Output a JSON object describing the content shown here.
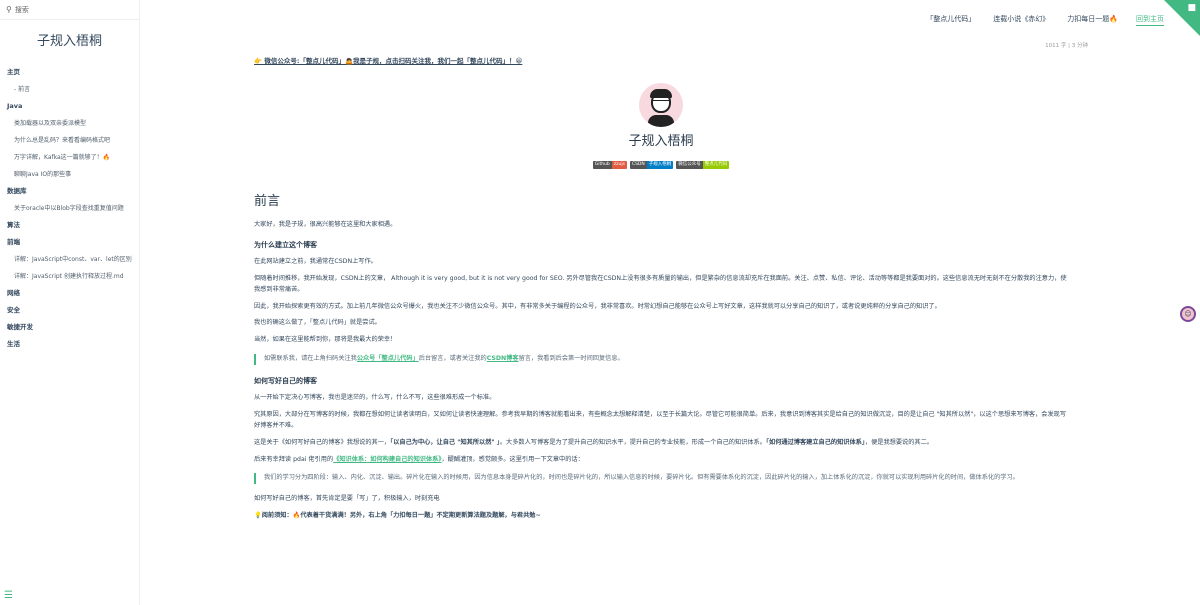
{
  "sidebar": {
    "search_placeholder": "搜索",
    "app_name": "子规入梧桐",
    "groups": [
      {
        "label": "主页",
        "items": [
          "- 前言"
        ]
      },
      {
        "label": "Java",
        "items": [
          "类加载器以及双亲委派模型",
          "为什么总是乱码？来看看编码格式吧",
          "万字详解，Kafka这一篇就够了！🔥",
          "聊聊Java IO的那些事"
        ]
      },
      {
        "label": "数据库",
        "items": [
          "关于oracle中以Blob字段查找重复值问题"
        ]
      },
      {
        "label": "算法",
        "items": []
      },
      {
        "label": "前端",
        "items": [
          "详解：JavaScript中const、var、let的区别",
          "详解：JavaScript 创建执行释放过程.md"
        ]
      },
      {
        "label": "网络",
        "items": []
      },
      {
        "label": "安全",
        "items": []
      },
      {
        "label": "敏捷开发",
        "items": []
      },
      {
        "label": "生活",
        "items": []
      }
    ]
  },
  "topnav": {
    "items": [
      "「整点儿代码」",
      "连载小说《赤幻》",
      "力扣每日一题🔥",
      "回到主页"
    ]
  },
  "meta": {
    "wordcount": "1011 字 | 3 分钟"
  },
  "content": {
    "notice": "👉 微信公众号:「整点儿代码」🙇我是子规，点击扫码关注我，我们一起「整点儿代码」！😀",
    "profile_name": "子规入梧桐",
    "badges": [
      {
        "k": "Github",
        "v": "zzujs",
        "color": "#e05d44"
      },
      {
        "k": "CSDN",
        "v": "子规入梧桐",
        "color": "#007ec6"
      },
      {
        "k": "微信公众号",
        "v": "整点儿代码",
        "color": "#97ca00"
      }
    ],
    "heading": "前言",
    "intro": "大家好，我是子规，很高兴能够在这里和大家相遇。",
    "why_title": "为什么建立这个博客",
    "p1": "在此网站建立之前，我通常在CSDN上写作。",
    "p2": "但随着时间推移，我开始发现，CSDN上的文章， Although it is very good, but it is not very good for SEO. 另外尽管我在CSDN上没有很多有质量的输出，但是繁杂的信息流却充斥在我面前。关注、点赞、私信、评论、活动等等都是我要面对的。这些信息流无时无刻不在分散我的注意力，使我感到非常痛苦。",
    "p3": "因此，我开始探索更有效的方式。加上前几年微信公众号爆火，我也关注不少微信公众号。其中，有非常多关于编程的公众号，我非常喜欢。时常幻想自己能够在公众号上写好文章，这样我就可以分享自己的知识了，或者说更纯粹的分享自己的知识了。",
    "p4": "我也的确这么做了，「整点儿代码」就是尝试。",
    "p5": "当然，如果在这里能帮到你，那将是我最大的荣幸！",
    "quote1_a": "如需联系我，请在上角扫码关注我",
    "quote1_link1": "公众号「整点儿代码」",
    "quote1_b": "后台留言，或者关注我的",
    "quote1_link2": "CSDN博客",
    "quote1_c": "留言，我看到后会第一时间回复信息。",
    "how_title": "如何写好自己的博客",
    "p6": "从一开始下定决心写博客，我也是迷茫的，什么写，什么不写，这些很难形成一个标准。",
    "p7": "究其原因，大部分在写博客的时候，我都在想如何让读者读明白，又如何让读者快速理解。参考我早期的博客就能看出来，有些概念太想解释清楚，以至于长篇大论。尽管它可能很简单。后来，我意识到博客其实是给自己的知识做沉淀，目的是让自己 \"知其所以然\"，以这个思想来写博客，会发现写好博客并不难。",
    "p8_a": "这是关于《如何写好自己的博客》我想说的其一，",
    "p8_b": "「以自己为中心，让自己 \"知其所以然\" 」",
    "p8_c": "。大多数人写博客是为了提升自己的知识水平，提升自己的专业技能，形成一个自己的知识体系。",
    "p8_d": "「如何通过博客建立自己的知识体系」",
    "p8_e": "，便是我想要说的其二。",
    "p9_a": "后来有幸拜读 pdai 佬引用的",
    "p9_link": "《知识体系：如何构建自己的知识体系》",
    "p9_b": "，醍醐灌顶，感觉颇多。这里引用一下文章中的话：",
    "quote2": "我们的学习分为四阶段：输入、内化、沉淀、输出。碎片化在输入的时候用，因为信息本身是碎片化的，时间也是碎片化的，所以输入信息的时候，要碎片化。但有需要体系化的沉淀，因此碎片化的输入，加上体系化的沉淀，你就可以实现利用碎片化的时间，做体系化的学习。",
    "p10": "如何写好自己的博客，首先肯定是要「写」了，积极输入，时刻充电",
    "p11": "💡阅前须知：🔥代表着干货满满！另外，右上角「力扣每日一题」不定期更新算法题及题解，与君共勉~"
  }
}
